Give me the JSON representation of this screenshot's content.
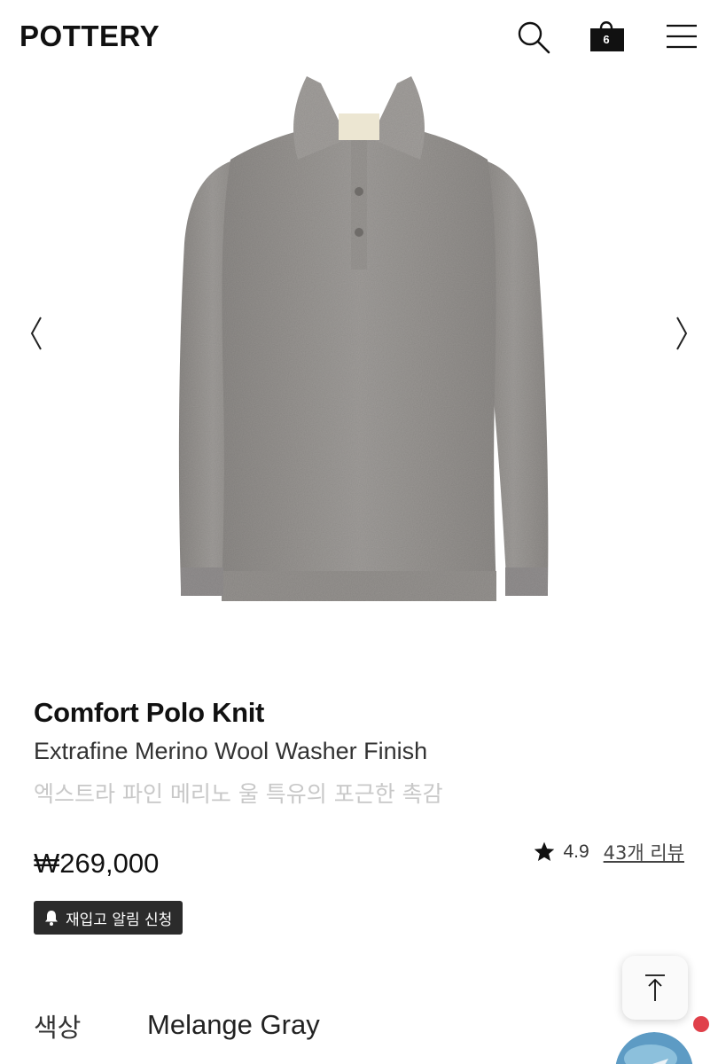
{
  "header": {
    "logo": "POTTERY",
    "cart_count": "6"
  },
  "icons": {
    "search": "search-icon",
    "cart": "shopping-bag-icon",
    "menu": "hamburger-menu-icon",
    "prev": "chevron-left-icon",
    "next": "chevron-right-icon",
    "star": "star-icon",
    "bell": "bell-icon",
    "scroll_top": "arrow-up-icon"
  },
  "product": {
    "title": "Comfort Polo Knit",
    "subtitle": "Extrafine Merino Wool Washer Finish",
    "description_ko": "엑스트라 파인 메리노 울 특유의 포근한 촉감",
    "price": "₩269,000",
    "rating": "4.9",
    "reviews_link": "43개 리뷰",
    "restock_button": "재입고 알림 신청",
    "color_label": "색상",
    "color_value": "Melange Gray"
  },
  "colors": {
    "accent_dark": "#2b2b2b",
    "notification": "#e0404a",
    "sweater": "#9d9a97"
  }
}
